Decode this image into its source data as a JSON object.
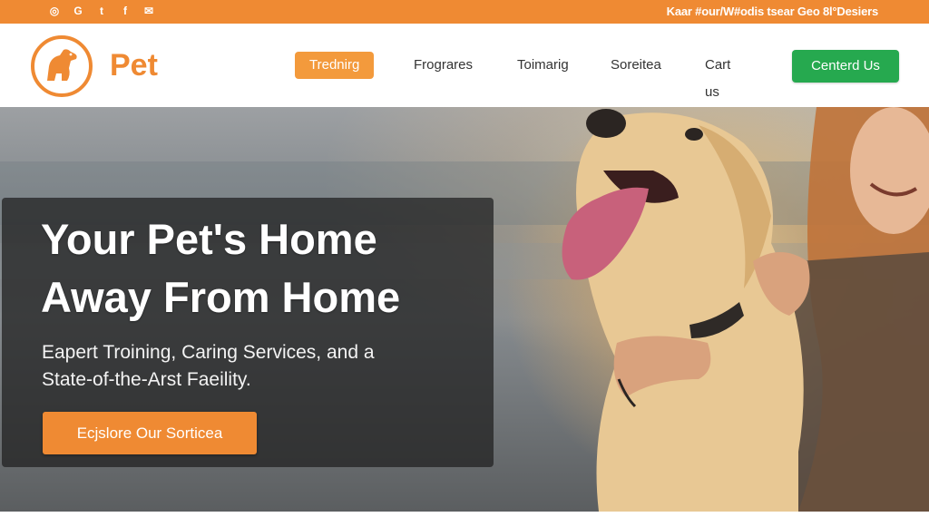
{
  "topbar": {
    "social_icons": [
      "instagram-icon",
      "google-plus-icon",
      "twitter-icon",
      "facebook-icon",
      "email-icon"
    ],
    "note": "Kaar #our/W#odis tsear Geo 8l°Desiers",
    "color": "#ef8a33"
  },
  "header": {
    "logo_text": "Pet",
    "logo_icon": "dog-logo-icon",
    "brand_color": "#ef8a33",
    "nav": [
      {
        "label": "Trednirg",
        "active": true
      },
      {
        "label": "Frograres",
        "active": false
      },
      {
        "label": "Toimarig",
        "active": false
      },
      {
        "label": "Soreitea",
        "active": false
      },
      {
        "label": "Cart us",
        "active": false
      }
    ],
    "contact_label": "Centerd Us",
    "contact_color": "#26a94f"
  },
  "hero": {
    "headline_line1": "Your Pet's Home",
    "headline_line2": "Away From Home",
    "subline_line1": "Eapert Troining, Caring Services, and a",
    "subline_line2": "State-of-the-Arst Faeility.",
    "cta_label": "Ecjslore Our Sorticea",
    "cta_color": "#ef8a33"
  }
}
